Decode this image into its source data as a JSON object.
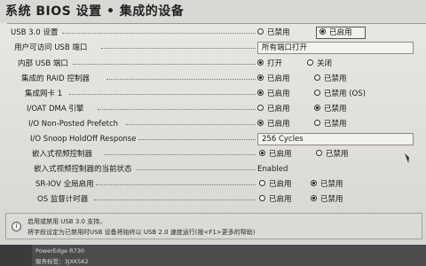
{
  "title": "系统 BIOS 设置 • 集成的设备",
  "rows": [
    {
      "label": "USB 3.0 设置",
      "options": [
        "已禁用",
        "已启用"
      ],
      "selected": 1
    },
    {
      "label": "用户可访问 USB 端口",
      "value": "所有端口打开"
    },
    {
      "label": "内部 USB 端口",
      "options": [
        "打开",
        "关闭"
      ],
      "selected": 0
    },
    {
      "label": "集成的 RAID 控制器",
      "options": [
        "已启用",
        "已禁用"
      ],
      "selected": 0
    },
    {
      "label": "集成网卡 1",
      "options": [
        "已启用",
        "已禁用 (OS)"
      ],
      "selected": 0
    },
    {
      "label": "I/OAT DMA 引擎",
      "options": [
        "已启用",
        "已禁用"
      ],
      "selected": 1
    },
    {
      "label": "I/O Non-Posted Prefetch",
      "options": [
        "已启用",
        "已禁用"
      ],
      "selected": 0
    },
    {
      "label": "I/O Snoop HoldOff Response",
      "value": "256 Cycles"
    },
    {
      "label": "嵌入式视频控制器",
      "options": [
        "已启用",
        "已禁用"
      ],
      "selected": 0
    },
    {
      "label": "嵌入式视频控制器的当前状态",
      "value": "Enabled"
    },
    {
      "label": "SR-IOV 全局启用",
      "options": [
        "已启用",
        "已禁用"
      ],
      "selected": 1
    },
    {
      "label": "OS 监督计时器",
      "options": [
        "已启用",
        "已禁用"
      ],
      "selected": 1
    }
  ],
  "help": {
    "line1": "启用或禁用 USB 3.0 支持。",
    "line2": "将字段设定为已禁用时USB 设备将始终以 USB 2.0 速度运行(按<F1>更多的帮助)"
  },
  "footer": {
    "model": "PowerEdge R730",
    "service_tag": "服务标签：3JXK5K2"
  }
}
